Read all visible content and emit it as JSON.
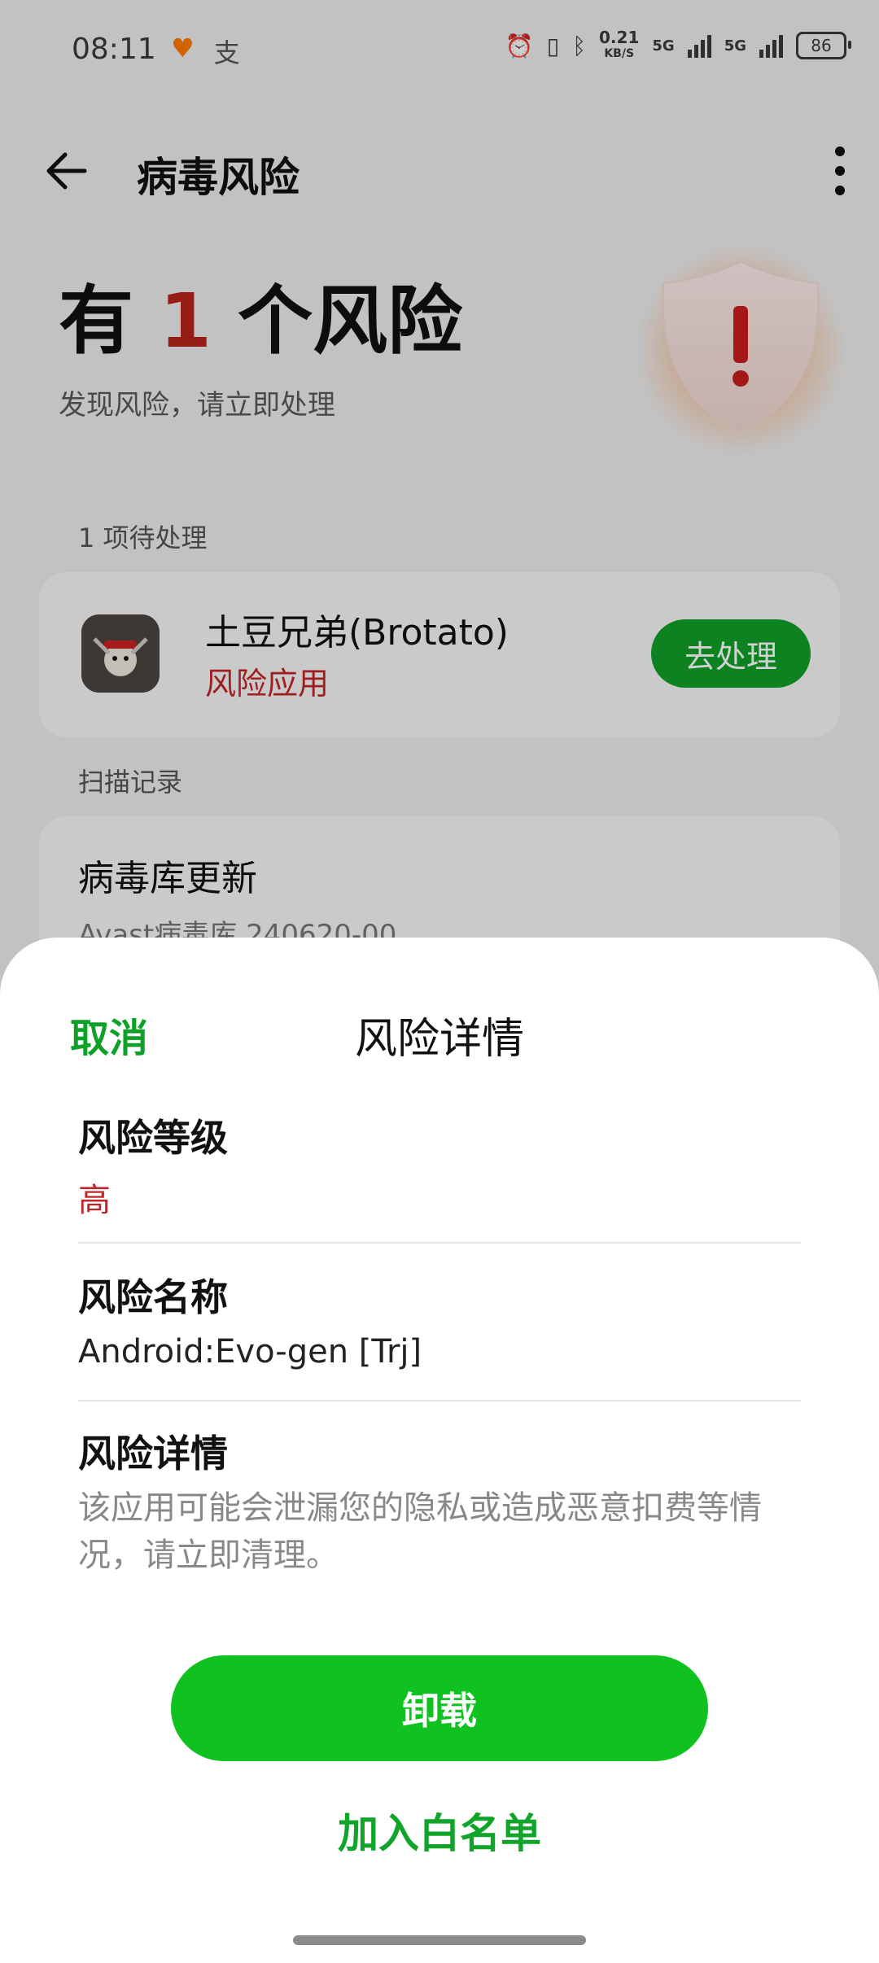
{
  "status_bar": {
    "time": "08:11",
    "speed_value": "0.21",
    "speed_unit": "KB/S",
    "network1": "5G",
    "network2": "5G",
    "battery": "86"
  },
  "header": {
    "title": "病毒风险"
  },
  "summary": {
    "prefix": "有",
    "count": "1",
    "suffix": "个风险",
    "subtitle": "发现风险，请立即处理"
  },
  "pending": {
    "label": "1 项待处理",
    "app_name": "土豆兄弟(Brotato)",
    "risk_type": "风险应用",
    "action_label": "去处理"
  },
  "scan_records": {
    "label": "扫描记录",
    "item_title": "病毒库更新",
    "item_sub": "Avast病毒库 240620-00"
  },
  "sheet": {
    "cancel_label": "取消",
    "title": "风险详情",
    "level_label": "风险等级",
    "level_value": "高",
    "name_label": "风险名称",
    "name_value": "Android:Evo-gen [Trj]",
    "detail_label": "风险详情",
    "detail_value": "该应用可能会泄漏您的隐私或造成恶意扣费等情况，请立即清理。",
    "uninstall_label": "卸载",
    "whitelist_label": "加入白名单"
  },
  "colors": {
    "accent_green": "#10c21f",
    "risk_red": "#c0262a"
  }
}
